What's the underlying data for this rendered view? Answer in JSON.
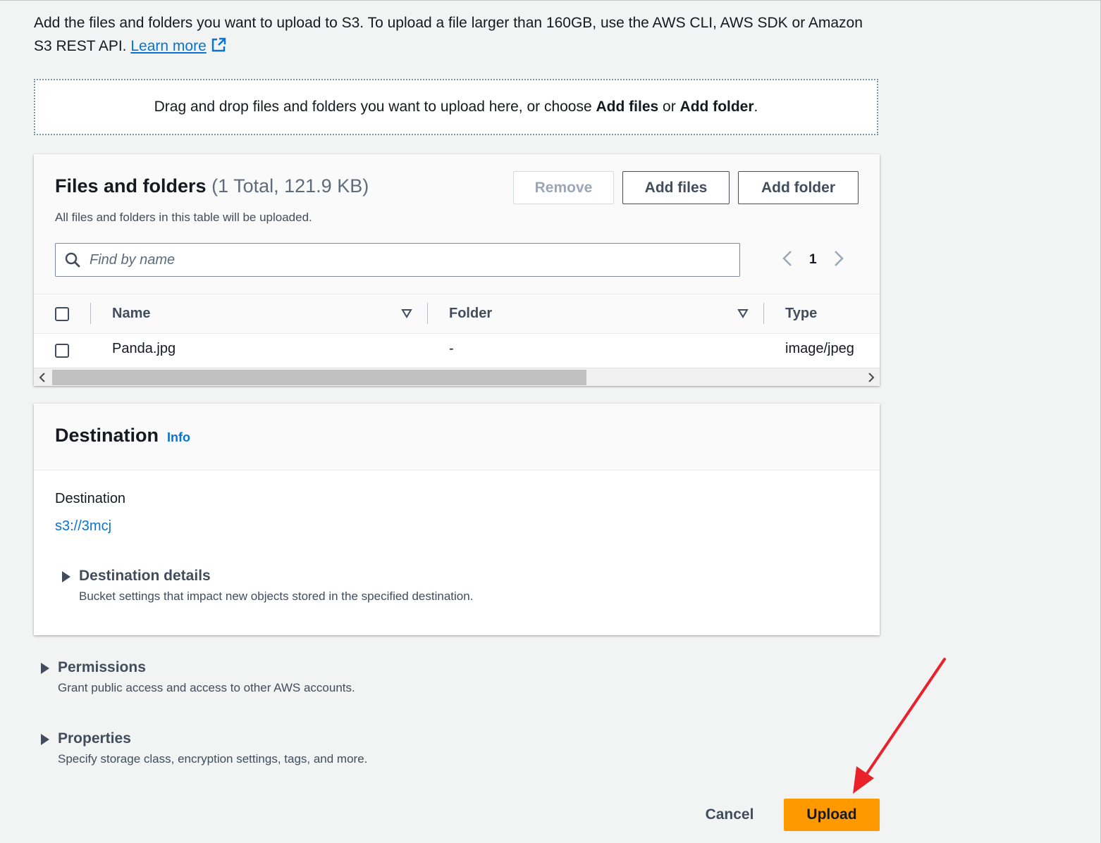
{
  "intro": {
    "text": "Add the files and folders you want to upload to S3. To upload a file larger than 160GB, use the AWS CLI, AWS SDK or Amazon S3 REST API.",
    "learn_more": "Learn more"
  },
  "dropzone": {
    "prefix": "Drag and drop files and folders you want to upload here, or choose ",
    "add_files": "Add files",
    "middle": " or ",
    "add_folder": "Add folder",
    "suffix": "."
  },
  "files_panel": {
    "title": "Files and folders",
    "count": "(1 Total, 121.9 KB)",
    "description": "All files and folders in this table will be uploaded.",
    "buttons": {
      "remove": "Remove",
      "add_files": "Add files",
      "add_folder": "Add folder"
    },
    "search_placeholder": "Find by name",
    "page": "1",
    "columns": {
      "name": "Name",
      "folder": "Folder",
      "type": "Type"
    },
    "rows": [
      {
        "name": "Panda.jpg",
        "folder": "-",
        "type": "image/jpeg"
      }
    ]
  },
  "destination": {
    "title": "Destination",
    "info": "Info",
    "label": "Destination",
    "value": "s3://3mcj",
    "details_title": "Destination details",
    "details_desc": "Bucket settings that impact new objects stored in the specified destination."
  },
  "permissions": {
    "title": "Permissions",
    "desc": "Grant public access and access to other AWS accounts."
  },
  "properties": {
    "title": "Properties",
    "desc": "Specify storage class, encryption settings, tags, and more."
  },
  "actions": {
    "cancel": "Cancel",
    "upload": "Upload"
  },
  "colors": {
    "accent": "#ff9900",
    "link": "#0972d3",
    "annotation_arrow": "#e8212b"
  }
}
